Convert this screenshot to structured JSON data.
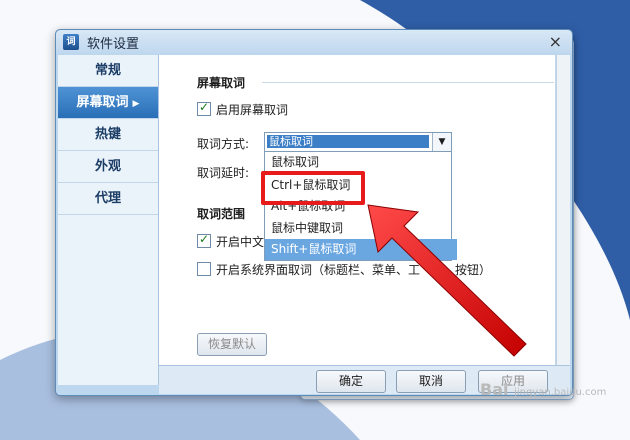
{
  "dialog": {
    "title": "软件设置",
    "icon": "app-icon",
    "close_glyph": "×"
  },
  "sidebar": {
    "items": [
      {
        "label": "常规",
        "active": false
      },
      {
        "label": "屏幕取词",
        "active": true
      },
      {
        "label": "热键",
        "active": false
      },
      {
        "label": "外观",
        "active": false
      },
      {
        "label": "代理",
        "active": false
      }
    ]
  },
  "screen_capture": {
    "section_title": "屏幕取词",
    "enable_label": "启用屏幕取词",
    "enable_checked": true,
    "method_label": "取词方式:",
    "method_value": "鼠标取词",
    "delay_label": "取词延时:",
    "method_options": [
      "鼠标取词",
      "Ctrl+鼠标取词",
      "Alt+鼠标取词",
      "鼠标中键取词",
      "Shift+鼠标取词"
    ],
    "highlighted_option": "Shift+鼠标取词"
  },
  "range": {
    "section_title": "取词范围",
    "chinese_label": "开启中文",
    "chinese_checked": true,
    "ui_label": "开启系统界面取词（标题栏、菜单、工",
    "ui_label_tail": "按钮）",
    "ui_checked": false
  },
  "buttons": {
    "restore": "恢复默认",
    "ok": "确定",
    "cancel": "取消",
    "apply": "应用"
  },
  "watermark": {
    "text": "Bai",
    "sub": "jingyan.baidu.com"
  },
  "colors": {
    "accent": "#2a6fb6",
    "highlight_red": "#e81b1b"
  }
}
